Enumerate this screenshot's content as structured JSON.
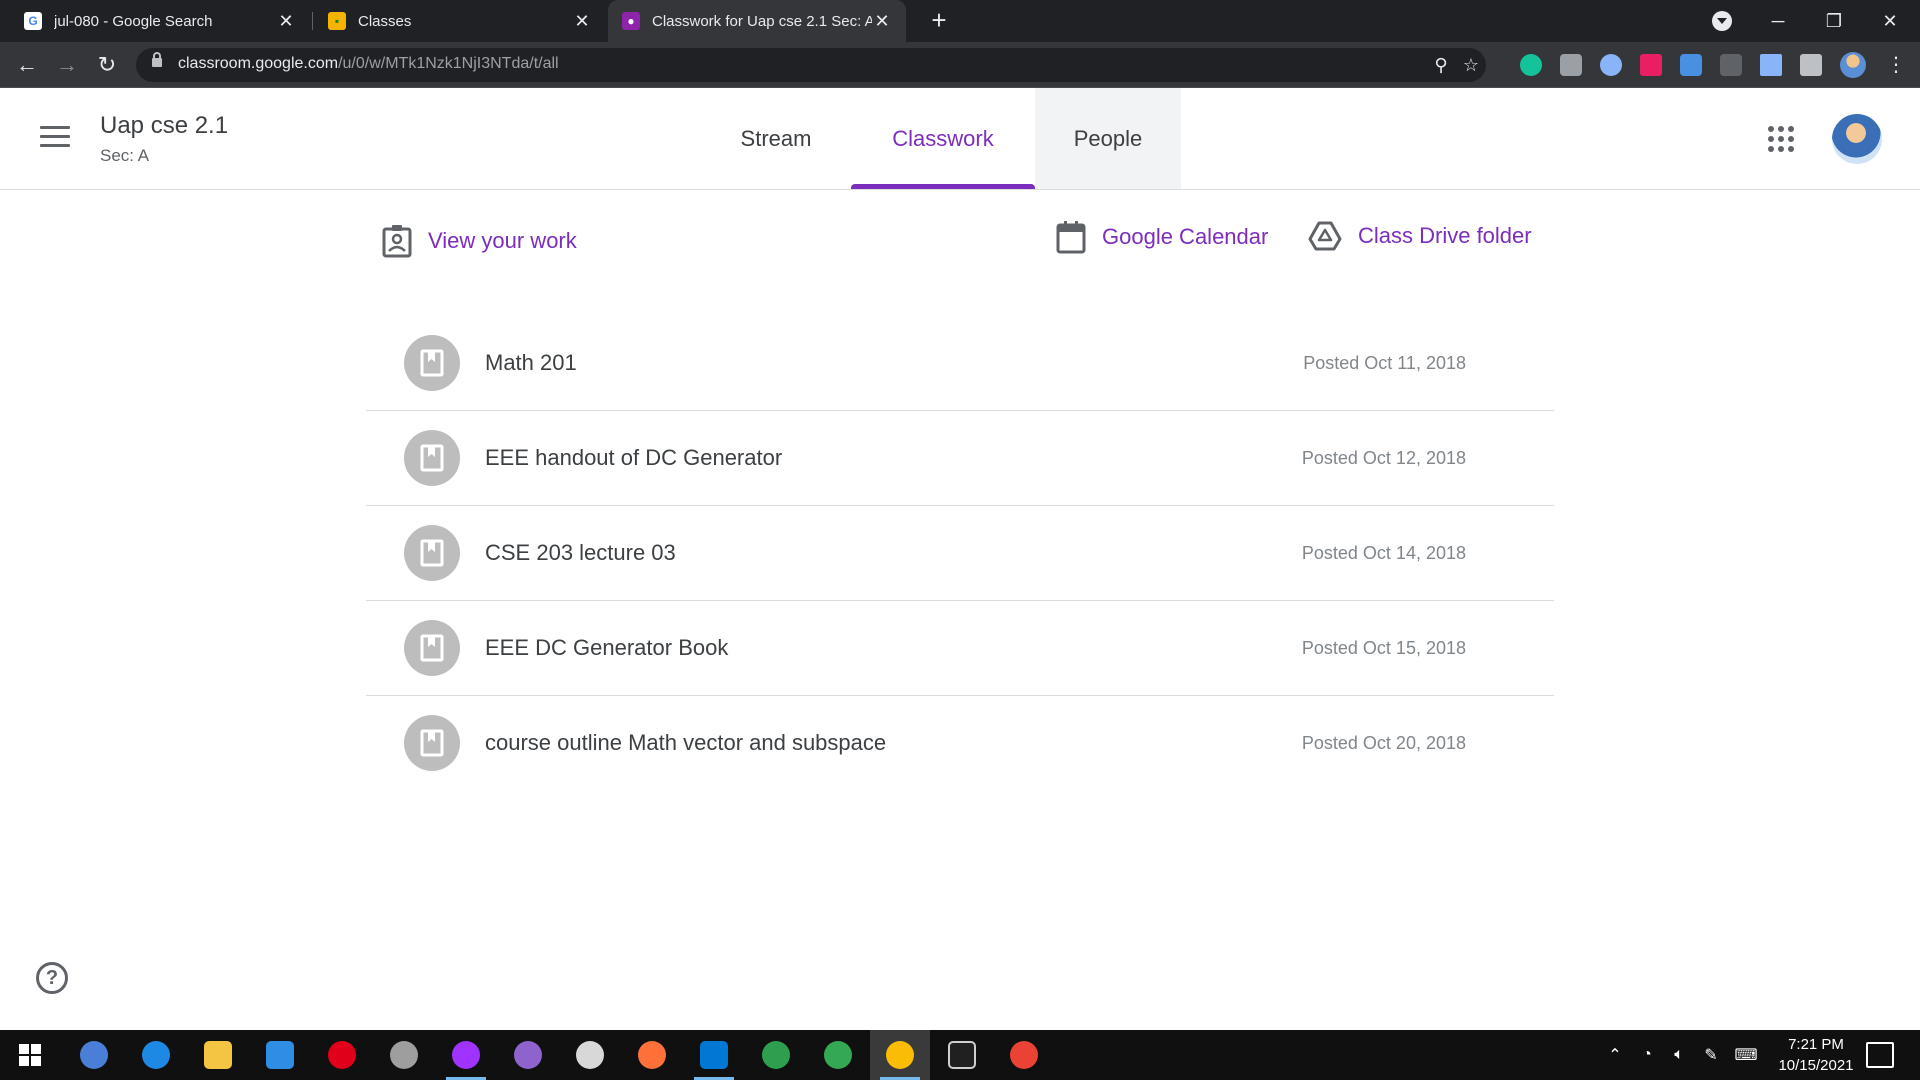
{
  "browser": {
    "tabs": [
      {
        "title": "jul-080 - Google Search",
        "active": false
      },
      {
        "title": "Classes",
        "active": false
      },
      {
        "title": "Classwork for Uap cse 2.1 Sec: A",
        "active": true
      }
    ],
    "url_host": "classroom.google.com",
    "url_path": "/u/0/w/MTk1Nzk1NjI3NTda/t/all"
  },
  "classroom": {
    "class_name": "Uap cse 2.1",
    "section": "Sec: A",
    "tabs": [
      {
        "label": "Stream"
      },
      {
        "label": "Classwork"
      },
      {
        "label": "People"
      }
    ],
    "actions": {
      "view_work": "View your work",
      "calendar": "Google Calendar",
      "drive": "Class Drive folder"
    },
    "materials": [
      {
        "title": "Math 201",
        "date": "Posted Oct 11, 2018"
      },
      {
        "title": "EEE handout of DC Generator",
        "date": "Posted Oct 12, 2018"
      },
      {
        "title": "CSE 203 lecture 03",
        "date": "Posted Oct 14, 2018"
      },
      {
        "title": "EEE DC Generator Book",
        "date": "Posted Oct 15, 2018"
      },
      {
        "title": "course outline Math vector and subspace",
        "date": "Posted Oct 20, 2018"
      }
    ],
    "help_label": "?"
  },
  "taskbar": {
    "time": "7:21 PM",
    "date": "10/15/2021"
  },
  "colors": {
    "accent": "#7b2dbd",
    "material_icon_bg": "#bdbdbd"
  }
}
